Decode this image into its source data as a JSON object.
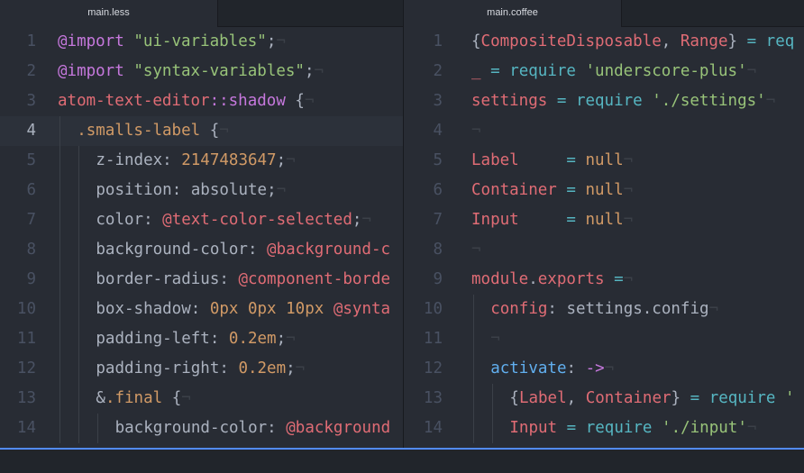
{
  "window": {
    "accent_color": "#528bff",
    "background": "#282c34"
  },
  "panes": [
    {
      "tab_label": "main.less",
      "cursor_line": 4,
      "lines": [
        {
          "num": "1",
          "indent": 0,
          "segments": [
            [
              "@import",
              "#c678dd"
            ],
            [
              " ",
              "#abb2bf"
            ],
            [
              "\"ui-variables\"",
              "#98c379"
            ],
            [
              ";",
              "#abb2bf"
            ],
            [
              "¬",
              "#3b4048"
            ]
          ]
        },
        {
          "num": "2",
          "indent": 0,
          "segments": [
            [
              "@import",
              "#c678dd"
            ],
            [
              " ",
              "#abb2bf"
            ],
            [
              "\"syntax-variables\"",
              "#98c379"
            ],
            [
              ";",
              "#abb2bf"
            ],
            [
              "¬",
              "#3b4048"
            ]
          ]
        },
        {
          "num": "3",
          "indent": 0,
          "segments": [
            [
              "atom-text-editor",
              "#e06c75"
            ],
            [
              "::shadow",
              "#c678dd"
            ],
            [
              " {",
              "#abb2bf"
            ],
            [
              "¬",
              "#3b4048"
            ]
          ]
        },
        {
          "num": "4",
          "indent": 1,
          "segments": [
            [
              ".smalls-label",
              "#d19a66"
            ],
            [
              " {",
              "#abb2bf"
            ],
            [
              "¬",
              "#3b4048"
            ]
          ]
        },
        {
          "num": "5",
          "indent": 2,
          "segments": [
            [
              "z-index",
              "#abb2bf"
            ],
            [
              ": ",
              "#abb2bf"
            ],
            [
              "2147483647",
              "#d19a66"
            ],
            [
              ";",
              "#abb2bf"
            ],
            [
              "¬",
              "#3b4048"
            ]
          ]
        },
        {
          "num": "6",
          "indent": 2,
          "segments": [
            [
              "position",
              "#abb2bf"
            ],
            [
              ": ",
              "#abb2bf"
            ],
            [
              "absolute",
              "#abb2bf"
            ],
            [
              ";",
              "#abb2bf"
            ],
            [
              "¬",
              "#3b4048"
            ]
          ]
        },
        {
          "num": "7",
          "indent": 2,
          "segments": [
            [
              "color",
              "#abb2bf"
            ],
            [
              ": ",
              "#abb2bf"
            ],
            [
              "@text-color-selected",
              "#e06c75"
            ],
            [
              ";",
              "#abb2bf"
            ],
            [
              "¬",
              "#3b4048"
            ]
          ]
        },
        {
          "num": "8",
          "indent": 2,
          "segments": [
            [
              "background-color",
              "#abb2bf"
            ],
            [
              ": ",
              "#abb2bf"
            ],
            [
              "@background-c",
              "#e06c75"
            ]
          ]
        },
        {
          "num": "9",
          "indent": 2,
          "segments": [
            [
              "border-radius",
              "#abb2bf"
            ],
            [
              ": ",
              "#abb2bf"
            ],
            [
              "@component-borde",
              "#e06c75"
            ]
          ]
        },
        {
          "num": "10",
          "indent": 2,
          "segments": [
            [
              "box-shadow",
              "#abb2bf"
            ],
            [
              ": ",
              "#abb2bf"
            ],
            [
              "0px",
              "#d19a66"
            ],
            [
              " ",
              "#abb2bf"
            ],
            [
              "0px",
              "#d19a66"
            ],
            [
              " ",
              "#abb2bf"
            ],
            [
              "10px",
              "#d19a66"
            ],
            [
              " ",
              "#abb2bf"
            ],
            [
              "@synta",
              "#e06c75"
            ]
          ]
        },
        {
          "num": "11",
          "indent": 2,
          "segments": [
            [
              "padding-left",
              "#abb2bf"
            ],
            [
              ": ",
              "#abb2bf"
            ],
            [
              "0.2em",
              "#d19a66"
            ],
            [
              ";",
              "#abb2bf"
            ],
            [
              "¬",
              "#3b4048"
            ]
          ]
        },
        {
          "num": "12",
          "indent": 2,
          "segments": [
            [
              "padding-right",
              "#abb2bf"
            ],
            [
              ": ",
              "#abb2bf"
            ],
            [
              "0.2em",
              "#d19a66"
            ],
            [
              ";",
              "#abb2bf"
            ],
            [
              "¬",
              "#3b4048"
            ]
          ]
        },
        {
          "num": "13",
          "indent": 2,
          "segments": [
            [
              "&",
              "#abb2bf"
            ],
            [
              ".final",
              "#d19a66"
            ],
            [
              " {",
              "#abb2bf"
            ],
            [
              "¬",
              "#3b4048"
            ]
          ]
        },
        {
          "num": "14",
          "indent": 3,
          "segments": [
            [
              "background-color",
              "#abb2bf"
            ],
            [
              ": ",
              "#abb2bf"
            ],
            [
              "@background",
              "#e06c75"
            ]
          ]
        }
      ]
    },
    {
      "tab_label": "main.coffee",
      "cursor_line": 0,
      "lines": [
        {
          "num": "1",
          "indent": 0,
          "segments": [
            [
              "{",
              "#abb2bf"
            ],
            [
              "CompositeDisposable",
              "#e06c75"
            ],
            [
              ", ",
              "#abb2bf"
            ],
            [
              "Range",
              "#e06c75"
            ],
            [
              "} ",
              "#abb2bf"
            ],
            [
              "=",
              "#56b6c2"
            ],
            [
              " ",
              "#abb2bf"
            ],
            [
              "req",
              "#56b6c2"
            ]
          ]
        },
        {
          "num": "2",
          "indent": 0,
          "segments": [
            [
              "_",
              "#e06c75"
            ],
            [
              " ",
              "#abb2bf"
            ],
            [
              "=",
              "#56b6c2"
            ],
            [
              " ",
              "#abb2bf"
            ],
            [
              "require",
              "#56b6c2"
            ],
            [
              " ",
              "#abb2bf"
            ],
            [
              "'underscore-plus'",
              "#98c379"
            ],
            [
              "¬",
              "#3b4048"
            ]
          ]
        },
        {
          "num": "3",
          "indent": 0,
          "segments": [
            [
              "settings",
              "#e06c75"
            ],
            [
              " ",
              "#abb2bf"
            ],
            [
              "=",
              "#56b6c2"
            ],
            [
              " ",
              "#abb2bf"
            ],
            [
              "require",
              "#56b6c2"
            ],
            [
              " ",
              "#abb2bf"
            ],
            [
              "'./settings'",
              "#98c379"
            ],
            [
              "¬",
              "#3b4048"
            ]
          ]
        },
        {
          "num": "4",
          "indent": 0,
          "segments": [
            [
              "¬",
              "#3b4048"
            ]
          ]
        },
        {
          "num": "5",
          "indent": 0,
          "segments": [
            [
              "Label",
              "#e06c75"
            ],
            [
              "     ",
              "#abb2bf"
            ],
            [
              "=",
              "#56b6c2"
            ],
            [
              " ",
              "#abb2bf"
            ],
            [
              "null",
              "#d19a66"
            ],
            [
              "¬",
              "#3b4048"
            ]
          ]
        },
        {
          "num": "6",
          "indent": 0,
          "segments": [
            [
              "Container",
              "#e06c75"
            ],
            [
              " ",
              "#abb2bf"
            ],
            [
              "=",
              "#56b6c2"
            ],
            [
              " ",
              "#abb2bf"
            ],
            [
              "null",
              "#d19a66"
            ],
            [
              "¬",
              "#3b4048"
            ]
          ]
        },
        {
          "num": "7",
          "indent": 0,
          "segments": [
            [
              "Input",
              "#e06c75"
            ],
            [
              "     ",
              "#abb2bf"
            ],
            [
              "=",
              "#56b6c2"
            ],
            [
              " ",
              "#abb2bf"
            ],
            [
              "null",
              "#d19a66"
            ],
            [
              "¬",
              "#3b4048"
            ]
          ]
        },
        {
          "num": "8",
          "indent": 0,
          "segments": [
            [
              "¬",
              "#3b4048"
            ]
          ]
        },
        {
          "num": "9",
          "indent": 0,
          "segments": [
            [
              "module",
              "#e06c75"
            ],
            [
              ".",
              "#abb2bf"
            ],
            [
              "exports",
              "#e06c75"
            ],
            [
              " ",
              "#abb2bf"
            ],
            [
              "=",
              "#56b6c2"
            ],
            [
              "¬",
              "#3b4048"
            ]
          ]
        },
        {
          "num": "10",
          "indent": 1,
          "segments": [
            [
              "config",
              "#e06c75"
            ],
            [
              ": ",
              "#abb2bf"
            ],
            [
              "settings.config",
              "#abb2bf"
            ],
            [
              "¬",
              "#3b4048"
            ]
          ]
        },
        {
          "num": "11",
          "indent": 1,
          "segments": [
            [
              "¬",
              "#3b4048"
            ]
          ]
        },
        {
          "num": "12",
          "indent": 1,
          "segments": [
            [
              "activate",
              "#61afef"
            ],
            [
              ": ",
              "#abb2bf"
            ],
            [
              "->",
              "#c678dd"
            ],
            [
              "¬",
              "#3b4048"
            ]
          ]
        },
        {
          "num": "13",
          "indent": 2,
          "segments": [
            [
              "{",
              "#abb2bf"
            ],
            [
              "Label",
              "#e06c75"
            ],
            [
              ", ",
              "#abb2bf"
            ],
            [
              "Container",
              "#e06c75"
            ],
            [
              "} ",
              "#abb2bf"
            ],
            [
              "=",
              "#56b6c2"
            ],
            [
              " ",
              "#abb2bf"
            ],
            [
              "require",
              "#56b6c2"
            ],
            [
              " '",
              "#98c379"
            ]
          ]
        },
        {
          "num": "14",
          "indent": 2,
          "segments": [
            [
              "Input",
              "#e06c75"
            ],
            [
              " ",
              "#abb2bf"
            ],
            [
              "=",
              "#56b6c2"
            ],
            [
              " ",
              "#abb2bf"
            ],
            [
              "require",
              "#56b6c2"
            ],
            [
              " ",
              "#abb2bf"
            ],
            [
              "'./input'",
              "#98c379"
            ],
            [
              "¬",
              "#3b4048"
            ]
          ]
        }
      ]
    }
  ]
}
